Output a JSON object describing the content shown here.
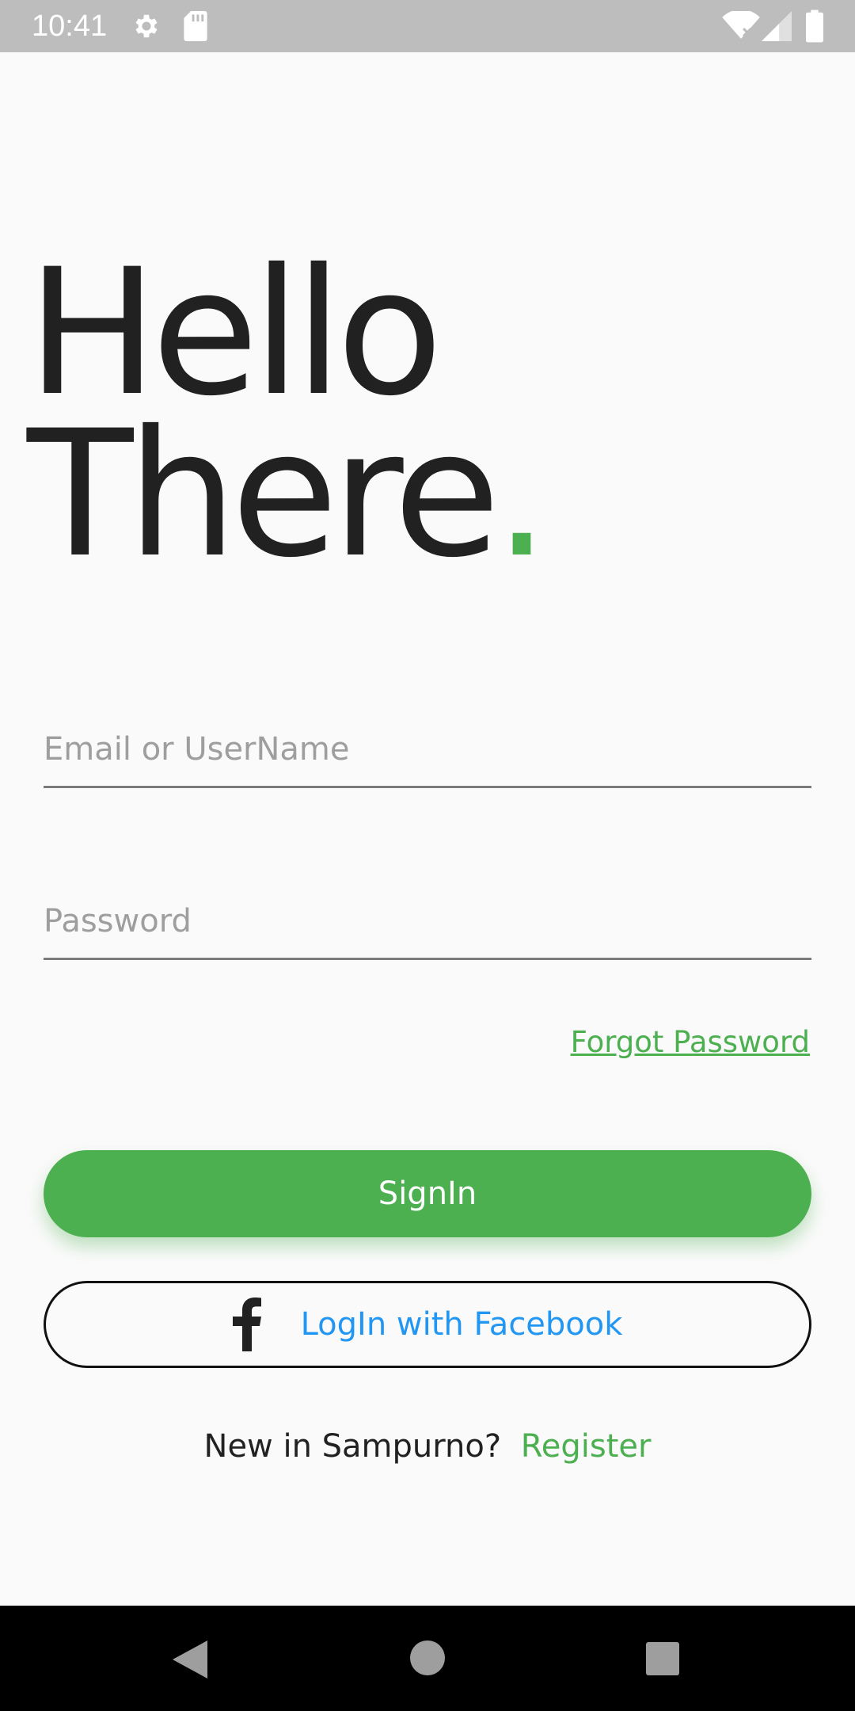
{
  "status_bar": {
    "time": "10:41",
    "icons": [
      "gear-icon",
      "sd-card-icon",
      "wifi-icon",
      "signal-icon",
      "battery-icon"
    ]
  },
  "headline": {
    "line1": "Hello",
    "line2": "There",
    "dot": "."
  },
  "form": {
    "email_placeholder": "Email or UserName",
    "email_value": "",
    "password_placeholder": "Password",
    "password_value": "",
    "forgot_label": "Forgot Password"
  },
  "buttons": {
    "signin_label": "SignIn",
    "facebook_label": "LogIn with Facebook"
  },
  "register": {
    "prompt": "New in Sampurno?",
    "link": "Register"
  },
  "colors": {
    "accent": "#4caf50",
    "facebook_text": "#2196f3",
    "text": "#212121",
    "status_bar": "#bdbdbd",
    "nav_bar": "#000000"
  },
  "nav_bar": {
    "buttons": [
      "back-icon",
      "home-icon",
      "recents-icon"
    ]
  }
}
